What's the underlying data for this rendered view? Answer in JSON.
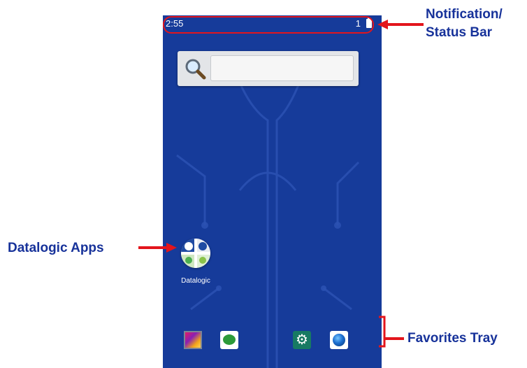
{
  "status_bar": {
    "time": "2:55",
    "notification_count": "1"
  },
  "search_widget": {
    "placeholder": ""
  },
  "home_apps": [
    {
      "label": "Datalogic",
      "icon": "datalogic-folder-icon"
    }
  ],
  "favorites_tray": [
    {
      "icon": "gallery-icon"
    },
    {
      "icon": "barcode-scanner-icon"
    },
    {
      "icon": "settings-icon"
    },
    {
      "icon": "browser-globe-icon"
    }
  ],
  "callouts": {
    "notification_line1": "Notification/",
    "notification_line2": "Status Bar",
    "datalogic_apps": "Datalogic Apps",
    "favorites_tray": "Favorites Tray"
  },
  "colors": {
    "wallpaper": "#163b9a",
    "callout_text": "#17329a",
    "callout_line": "#e3151c"
  }
}
